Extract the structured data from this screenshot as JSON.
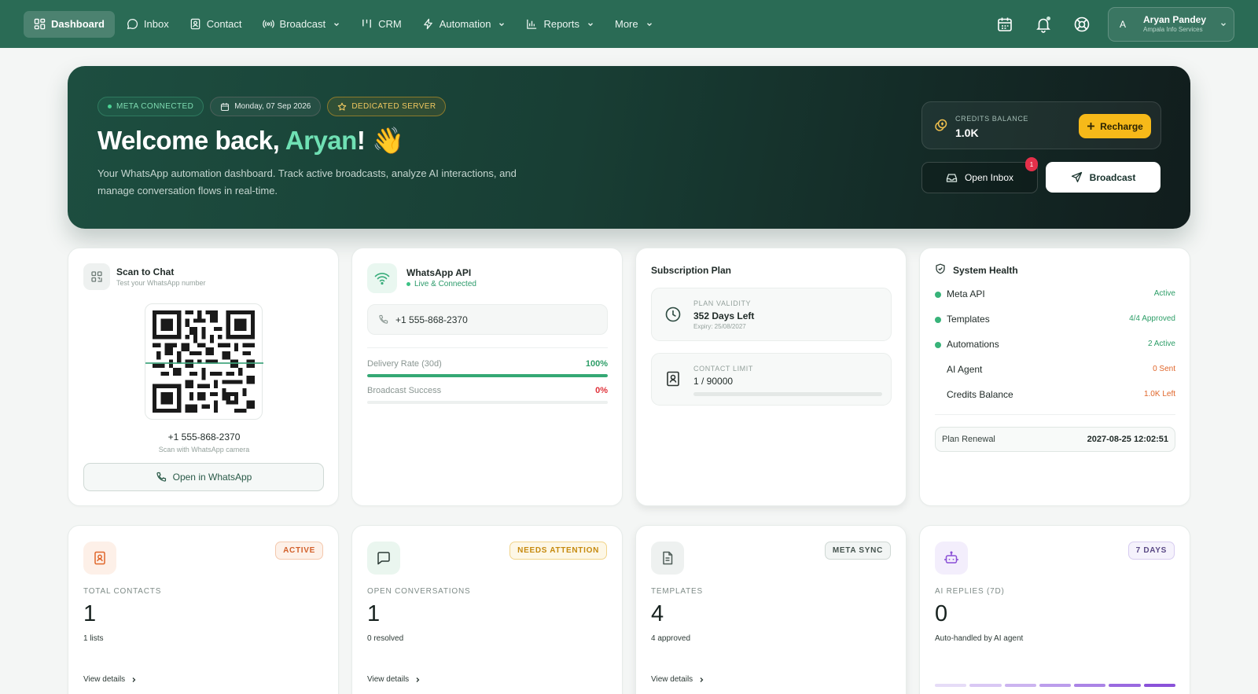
{
  "nav": {
    "items": [
      {
        "label": "Dashboard",
        "icon": "grid-icon"
      },
      {
        "label": "Inbox",
        "icon": "chat-bubble-icon"
      },
      {
        "label": "Contact",
        "icon": "contact-card-icon"
      },
      {
        "label": "Broadcast",
        "icon": "broadcast-icon"
      },
      {
        "label": "CRM",
        "icon": "kanban-icon"
      },
      {
        "label": "Automation",
        "icon": "lightning-icon"
      },
      {
        "label": "Reports",
        "icon": "bar-chart-icon"
      },
      {
        "label": "More"
      }
    ],
    "user": {
      "initial": "A",
      "name": "Aryan Pandey",
      "org": "Ampala Info Services"
    }
  },
  "hero": {
    "badge_meta": "META CONNECTED",
    "badge_date": "Monday, 07 Sep 2026",
    "badge_server": "DEDICATED SERVER",
    "title_prefix": "Welcome back, ",
    "title_name": "Aryan",
    "title_suffix": "! 👋",
    "description": "Your WhatsApp automation dashboard. Track active broadcasts, analyze AI interactions, and manage conversation flows in real-time.",
    "credits_label": "CREDITS BALANCE",
    "credits_value": "1.0K",
    "recharge_label": "Recharge",
    "open_inbox_label": "Open Inbox",
    "inbox_badge": "1",
    "broadcast_label": "Broadcast"
  },
  "scan": {
    "title": "Scan to Chat",
    "subtitle": "Test your WhatsApp number",
    "phone": "+1 555-868-2370",
    "hint": "Scan with WhatsApp camera",
    "button": "Open in WhatsApp"
  },
  "api": {
    "title": "WhatsApp API",
    "status": "Live & Connected",
    "phone": "+1 555-868-2370",
    "delivery_label": "Delivery Rate (30d)",
    "delivery_value": "100%",
    "delivery_fraction": 1.0,
    "broadcast_label": "Broadcast Success",
    "broadcast_value": "0%",
    "broadcast_fraction": 0.0
  },
  "plan": {
    "title": "Subscription Plan",
    "validity_label": "PLAN VALIDITY",
    "validity_value": "352 Days Left",
    "validity_expiry": "Expiry: 25/08/2027",
    "limit_label": "CONTACT LIMIT",
    "limit_value": "1 / 90000"
  },
  "health": {
    "title": "System Health",
    "rows": [
      {
        "name": "Meta API",
        "value": "Active",
        "color": "#2e9e68",
        "dot": true
      },
      {
        "name": "Templates",
        "value": "4/4 Approved",
        "color": "#2e9e68",
        "dot": true
      },
      {
        "name": "Automations",
        "value": "2 Active",
        "color": "#2e9e68",
        "dot": true
      },
      {
        "name": "AI Agent",
        "value": "0 Sent",
        "color": "#e0662a",
        "dot": false
      },
      {
        "name": "Credits Balance",
        "value": "1.0K Left",
        "color": "#e0662a",
        "dot": false
      }
    ],
    "renewal_label": "Plan Renewal",
    "renewal_value": "2027-08-25 12:02:51"
  },
  "stats": [
    {
      "tag": "ACTIVE",
      "label": "TOTAL CONTACTS",
      "value": "1",
      "sub": "1 lists",
      "link": "View details"
    },
    {
      "tag": "NEEDS ATTENTION",
      "label": "OPEN CONVERSATIONS",
      "value": "1",
      "sub": "0 resolved",
      "link": "View details"
    },
    {
      "tag": "META SYNC",
      "label": "TEMPLATES",
      "value": "4",
      "sub": "4 approved",
      "link": "View details"
    },
    {
      "tag": "7 DAYS",
      "label": "AI REPLIES (7D)",
      "value": "0",
      "sub": "Auto-handled by AI agent"
    }
  ],
  "colors": {
    "nav_bg": "#2a6b55",
    "accent_green": "#6fe0b4",
    "recharge_yellow": "#f6b919",
    "alert_red": "#e5304a"
  }
}
